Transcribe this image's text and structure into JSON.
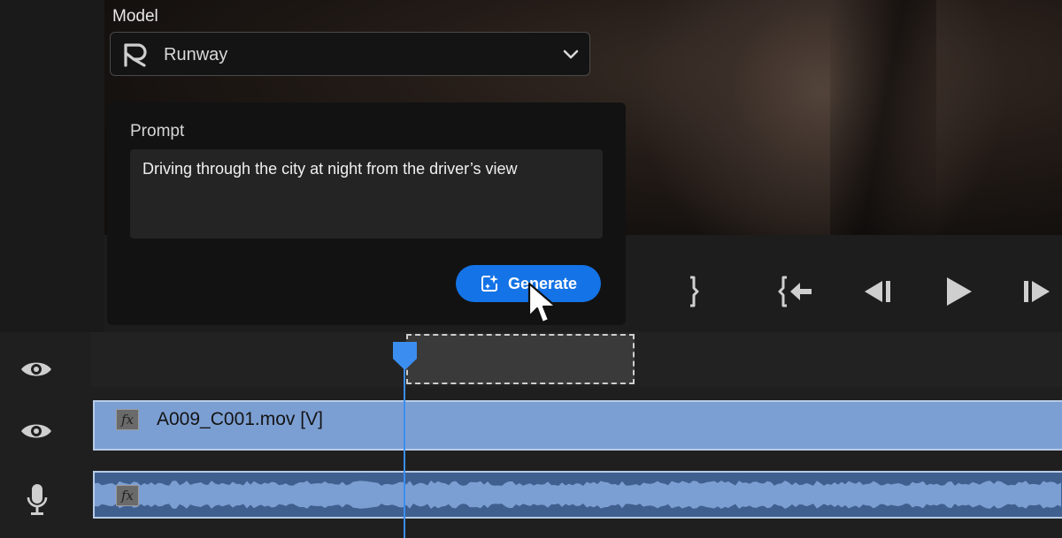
{
  "model": {
    "label": "Model",
    "selected": "Runway",
    "logo_icon": "runway-logo",
    "chevron_icon": "chevron-down-icon"
  },
  "prompt": {
    "label": "Prompt",
    "value": "Driving through the city at night from the driver’s view"
  },
  "generate": {
    "label": "Generate",
    "icon": "sparkle-frame-icon"
  },
  "transport": {
    "icons": [
      "mark-out-icon",
      "go-to-in-icon",
      "step-back-icon",
      "play-icon",
      "step-forward-icon"
    ]
  },
  "timeline": {
    "video_clip_name": "A009_C001.mov [V]",
    "fx_label": "fx",
    "track_icons": [
      "eye-icon",
      "eye-icon",
      "microphone-icon"
    ]
  },
  "colors": {
    "accent": "#1473e6",
    "video_clip": "#7c9fd3",
    "audio_clip": "#3f5f8f",
    "playhead": "#3b8ef0"
  }
}
